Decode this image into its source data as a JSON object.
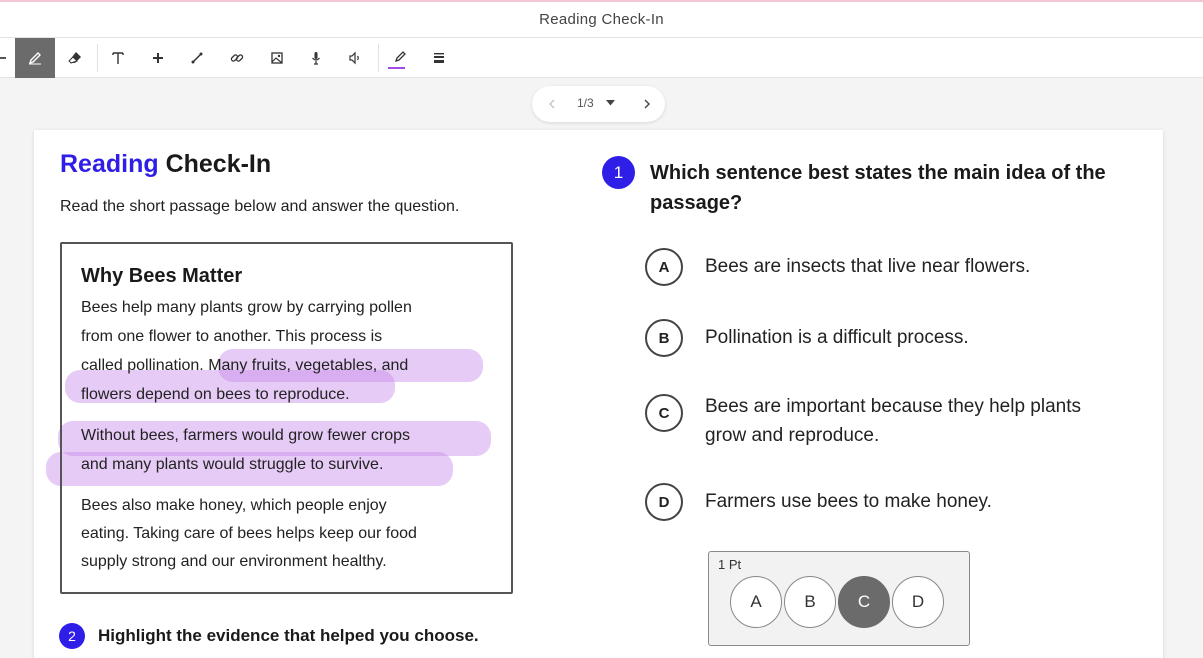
{
  "window": {
    "title": "Reading Check-In"
  },
  "toolbar": {
    "tools": [
      {
        "name": "pen-icon",
        "active": true
      },
      {
        "name": "eraser-icon"
      },
      {
        "name": "text-icon"
      },
      {
        "name": "plus-icon"
      },
      {
        "name": "line-icon"
      },
      {
        "name": "link-icon"
      },
      {
        "name": "image-icon"
      },
      {
        "name": "microphone-icon"
      },
      {
        "name": "speaker-icon"
      },
      {
        "name": "highlighter-icon",
        "color": "#a24be6"
      },
      {
        "name": "menu-lines-icon"
      }
    ]
  },
  "pager": {
    "label": "1/3"
  },
  "document": {
    "title_accent": "Reading",
    "title_rest": " Check-In",
    "instructions": "Read the short passage below and answer the question.",
    "passage": {
      "heading": "Why Bees Matter",
      "lines": [
        "Bees help many plants grow by carrying pollen",
        "from one flower to another. This process is",
        "called pollination. Many fruits, vegetables, and",
        "flowers depend on bees to reproduce.",
        "Without bees, farmers would grow fewer crops",
        "and many plants would struggle to survive.",
        "Bees also make honey, which people enjoy",
        "eating. Taking care of bees helps keep our food",
        "supply strong and our environment healthy."
      ]
    },
    "question1": {
      "number": "1",
      "text": "Which sentence best states the main idea of the passage?",
      "options": [
        {
          "letter": "A",
          "text": "Bees are insects that live near flowers."
        },
        {
          "letter": "B",
          "text": "Pollination is a difficult process."
        },
        {
          "letter": "C",
          "text": "Bees are important because they help plants grow and reproduce."
        },
        {
          "letter": "D",
          "text": "Farmers use bees to make honey."
        }
      ]
    },
    "question2": {
      "number": "2",
      "text": "Highlight the evidence that helped you choose."
    },
    "answer_panel": {
      "points": "1 Pt",
      "choices": [
        "A",
        "B",
        "C",
        "D"
      ],
      "selected": "C"
    },
    "highlight_color": "#c88ceb"
  }
}
